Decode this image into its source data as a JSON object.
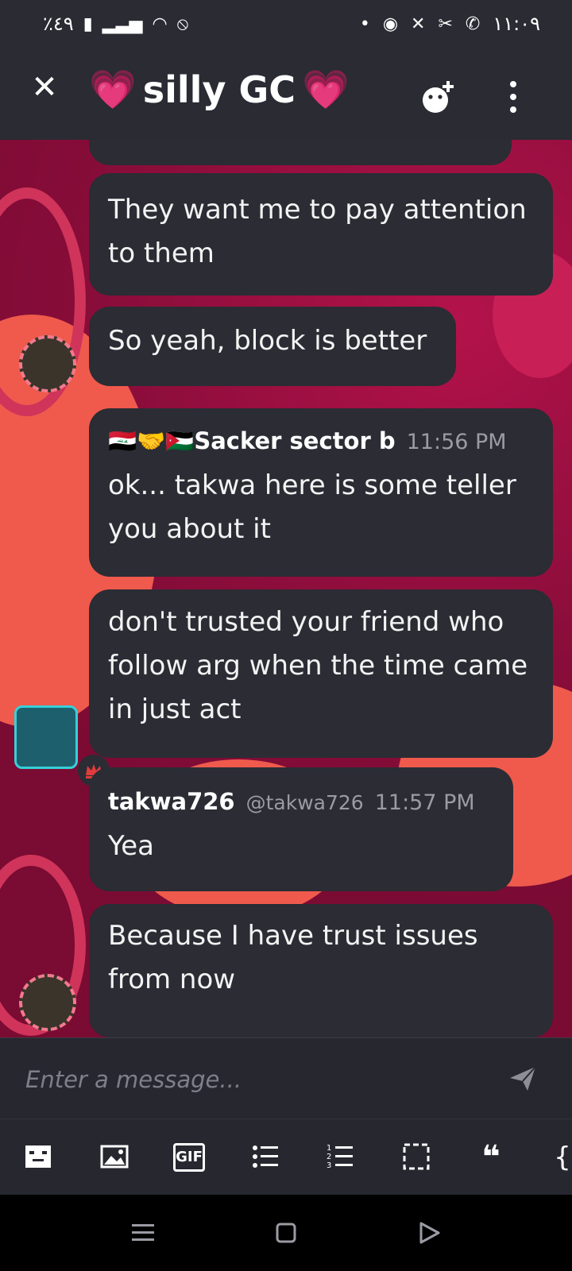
{
  "status_bar": {
    "battery": "٪٤٩",
    "time": "١١:٠٩"
  },
  "header": {
    "title": "silly GC",
    "emoji": "💗"
  },
  "messages": [
    {
      "text": "They want me to pay attention to them"
    },
    {
      "text": "So yeah, block is better"
    },
    {
      "username": "🇮🇶🤝🇯🇴Sacker sector b",
      "time": "11:56 PM",
      "text": "ok... takwa here is some teller you about it"
    },
    {
      "text": "don't trusted your friend who follow arg when the time came in just act"
    },
    {
      "username": "takwa726",
      "handle": "@takwa726",
      "time": "11:57 PM",
      "text": "Yea"
    },
    {
      "text": "Because I have trust issues from now"
    }
  ],
  "composer": {
    "placeholder": "Enter a message..."
  },
  "toolbar": {
    "gif_label": "GIF",
    "quote_label": "❝",
    "code_label": "{"
  },
  "colors": {
    "bubble": "#2b2c34",
    "background_red": "#8a0d3a",
    "crown": "#e23b3b"
  }
}
